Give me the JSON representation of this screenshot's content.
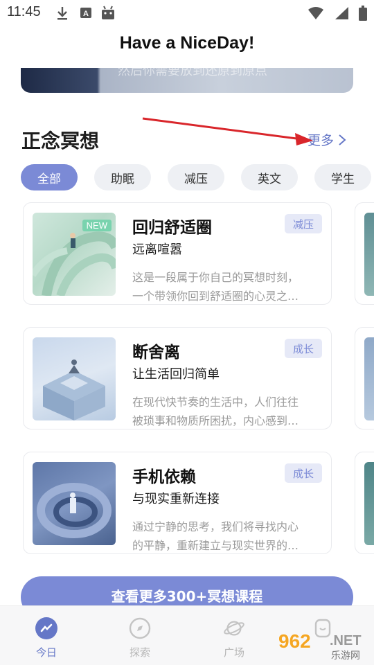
{
  "status_bar": {
    "time": "11:45",
    "icons_left": [
      "download-icon",
      "a-box-icon",
      "android-icon"
    ],
    "icons_right": [
      "wifi-icon",
      "signal-icon",
      "battery-icon"
    ]
  },
  "header": {
    "title": "Have a NiceDay!"
  },
  "banner": {
    "text": "然后你需要放到还原到原点"
  },
  "section": {
    "title": "正念冥想",
    "more_label": "更多"
  },
  "chips": [
    {
      "label": "全部",
      "active": true
    },
    {
      "label": "助眠",
      "active": false
    },
    {
      "label": "减压",
      "active": false
    },
    {
      "label": "英文",
      "active": false
    },
    {
      "label": "学生",
      "active": false
    }
  ],
  "cards": [
    {
      "title": "回归舒适圈",
      "subtitle": "远离喧嚣",
      "tag": "减压",
      "badge": "NEW",
      "desc_line1": "这是一段属于你自己的冥想时刻，",
      "desc_line2": "一个带领你回到舒适圈的心灵之…"
    },
    {
      "title": "断舍离",
      "subtitle": "让生活回归简单",
      "tag": "成长",
      "badge": "",
      "desc_line1": "在现代快节奏的生活中，人们往往",
      "desc_line2": "被琐事和物质所困扰，内心感到…"
    },
    {
      "title": "手机依赖",
      "subtitle": "与现实重新连接",
      "tag": "成长",
      "badge": "",
      "desc_line1": "通过宁静的思考，我们将寻找内心",
      "desc_line2": "的平静，重新建立与现实世界的…"
    }
  ],
  "cta": {
    "label": "查看更多300+冥想课程"
  },
  "tab_bar": {
    "tabs": [
      {
        "label": "今日",
        "icon": "today-icon",
        "active": true
      },
      {
        "label": "探索",
        "icon": "compass-icon",
        "active": false
      },
      {
        "label": "广场",
        "icon": "planet-icon",
        "active": false
      },
      {
        "label": "",
        "icon": "profile-icon",
        "active": false
      }
    ]
  },
  "watermark": {
    "number": "962",
    "suffix": ".NET",
    "site": "乐游网"
  },
  "colors": {
    "accent": "#7b8ad6",
    "accent_text": "#6577c7",
    "chip_bg": "#eef0f4",
    "tag_bg": "#e6e9f7",
    "annotation_arrow": "#d9262b"
  }
}
